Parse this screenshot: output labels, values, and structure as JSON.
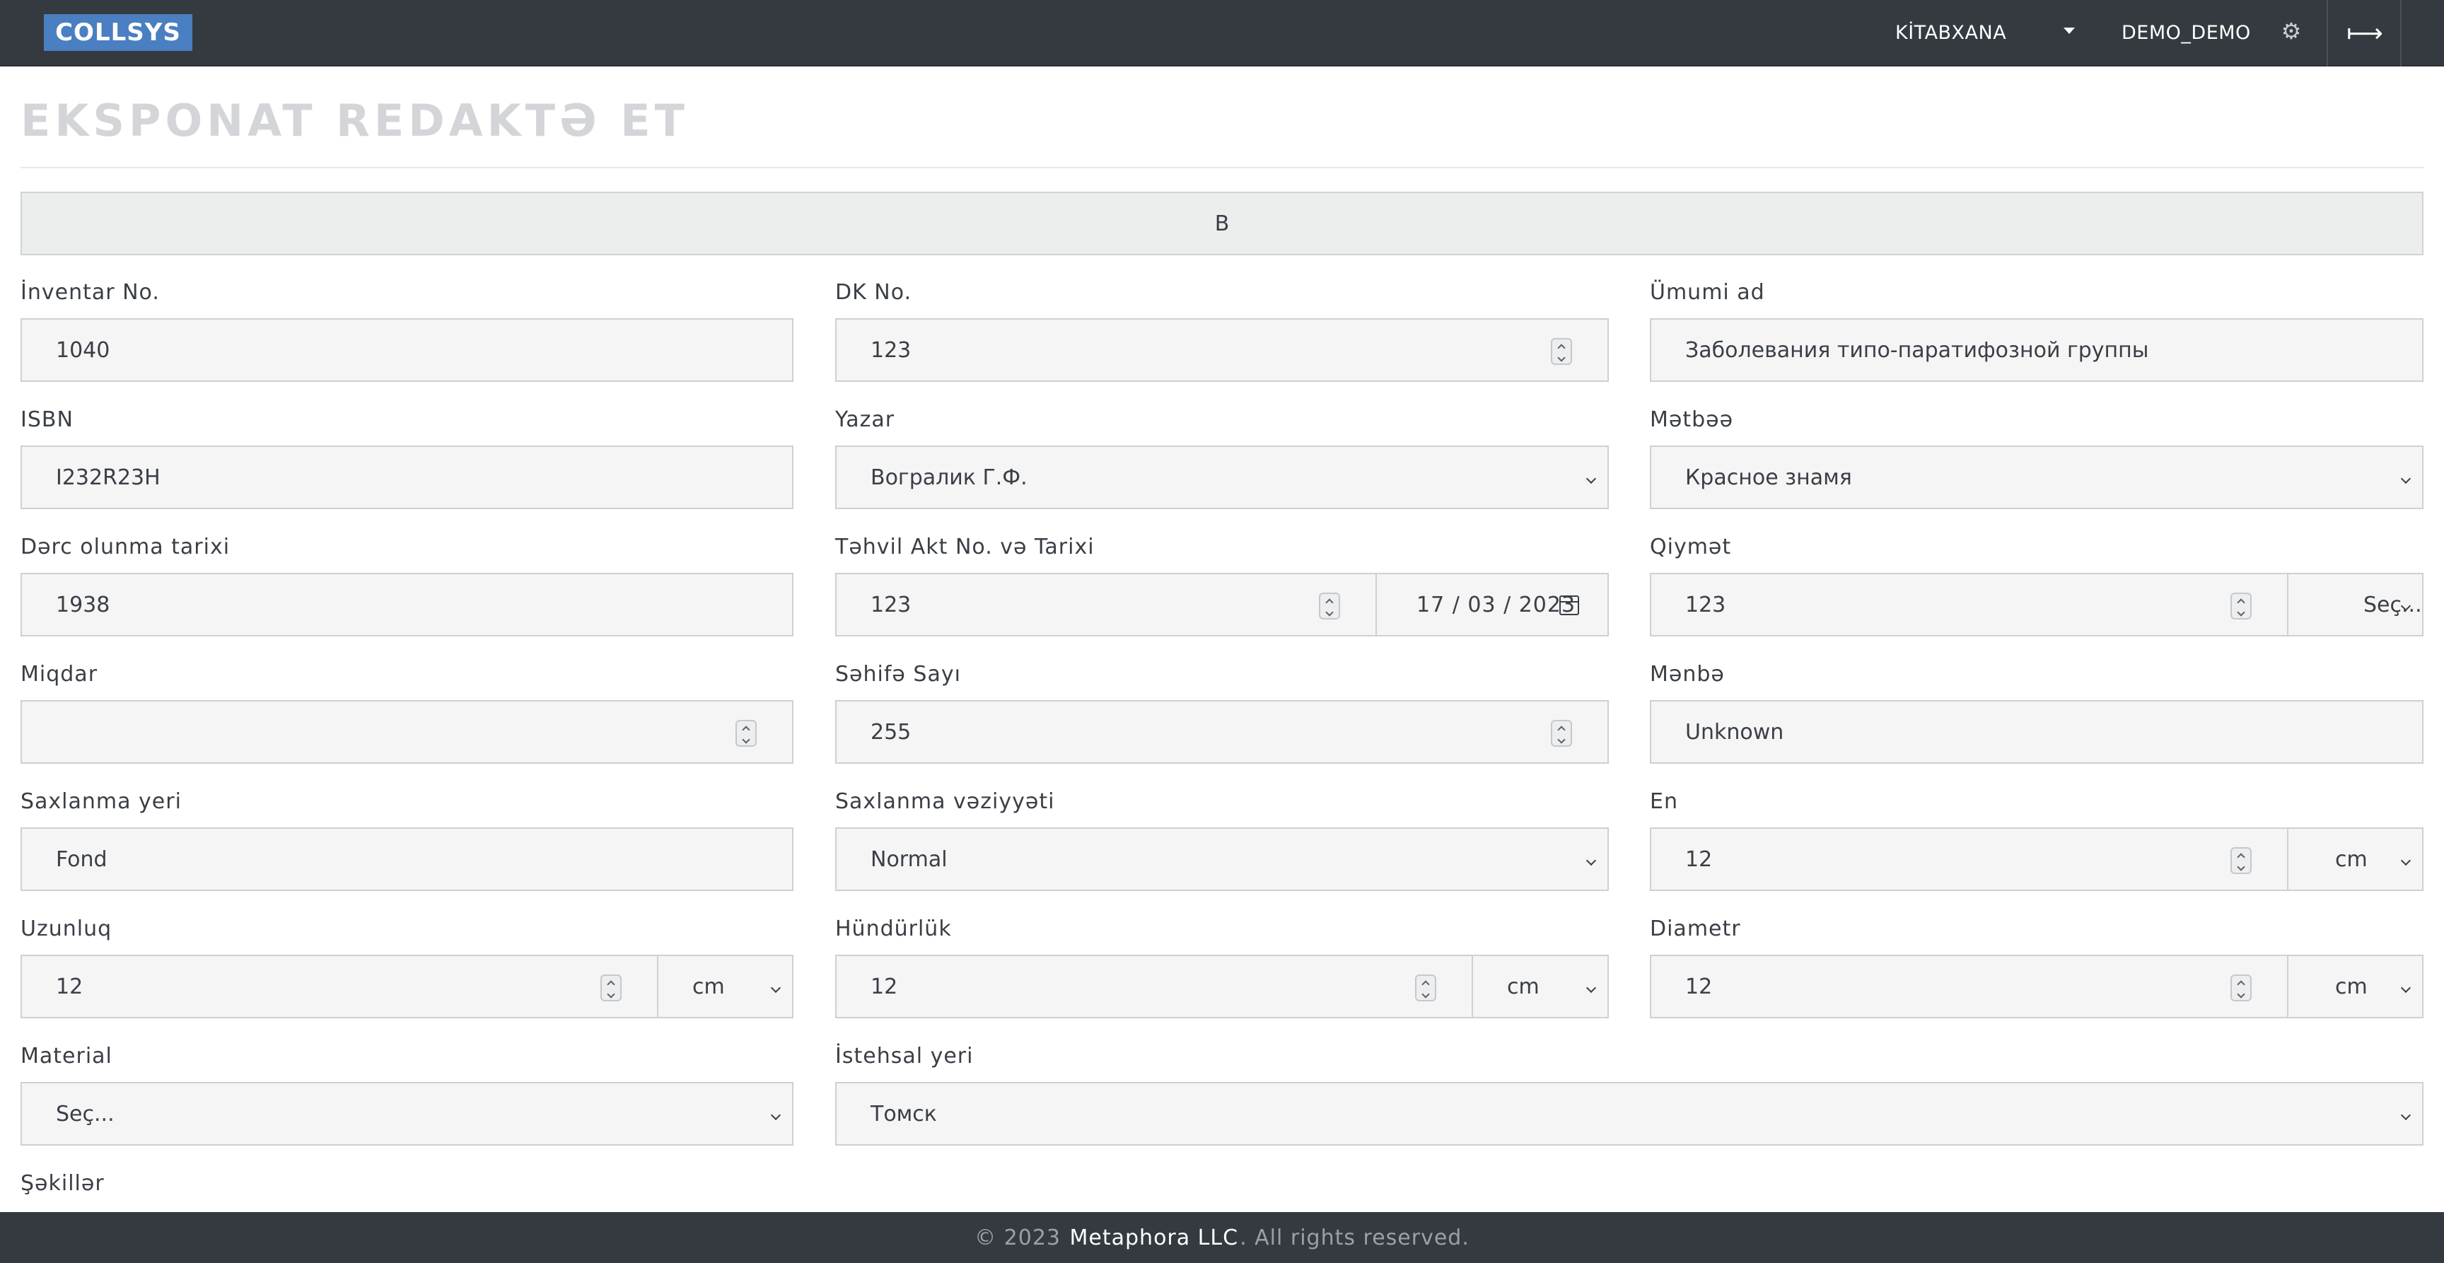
{
  "navbar": {
    "brand": "COLLSYS",
    "library": "KİTABXANA",
    "user": "DEMO_DEMO",
    "gear_icon": "⚙",
    "logout_icon": "⟼"
  },
  "page": {
    "title": "EKSPONAT REDAKTƏ ET",
    "bar_button": "B"
  },
  "form": {
    "inventar_no": {
      "label": "İnventar No.",
      "value": "1040"
    },
    "dk_no": {
      "label": "DK No.",
      "value": "123"
    },
    "umumi_ad": {
      "label": "Ümumi ad",
      "value": "Заболевания типо-паратифозной группы"
    },
    "isbn": {
      "label": "ISBN",
      "value": "I232R23H"
    },
    "yazar": {
      "label": "Yazar",
      "value": "Вогралик Г.Ф."
    },
    "metbee": {
      "label": "Mətbəə",
      "value": "Красное знамя"
    },
    "derc_tarixi": {
      "label": "Dərc olunma tarixi",
      "value": "1938"
    },
    "tehvil_akt": {
      "label": "Təhvil Akt No. və Tarixi",
      "number": "123",
      "date": "17 / 03 / 2023"
    },
    "qiymet": {
      "label": "Qiymət",
      "value": "123",
      "currency": "Seç..."
    },
    "miqdar": {
      "label": "Miqdar",
      "value": ""
    },
    "sehife_sayi": {
      "label": "Səhifə Sayı",
      "value": "255"
    },
    "menbe": {
      "label": "Mənbə",
      "value": "Unknown"
    },
    "saxlanma_yeri": {
      "label": "Saxlanma yeri",
      "value": "Fond"
    },
    "saxlanma_veziyyeti": {
      "label": "Saxlanma vəziyyəti",
      "value": "Normal"
    },
    "en": {
      "label": "En",
      "value": "12",
      "unit": "cm"
    },
    "uzunluq": {
      "label": "Uzunluq",
      "value": "12",
      "unit": "cm"
    },
    "hundurluk": {
      "label": "Hündürlük",
      "value": "12",
      "unit": "cm"
    },
    "diametr": {
      "label": "Diametr",
      "value": "12",
      "unit": "cm"
    },
    "material": {
      "label": "Material",
      "value": "Seç..."
    },
    "istehsal_yeri": {
      "label": "İstehsal yeri",
      "value": "Томск"
    },
    "sekiller": {
      "label": "Şəkillər"
    }
  },
  "footer": {
    "prefix": "© 2023 ",
    "company": "Metaphora LLC",
    "suffix": ". All rights reserved."
  }
}
